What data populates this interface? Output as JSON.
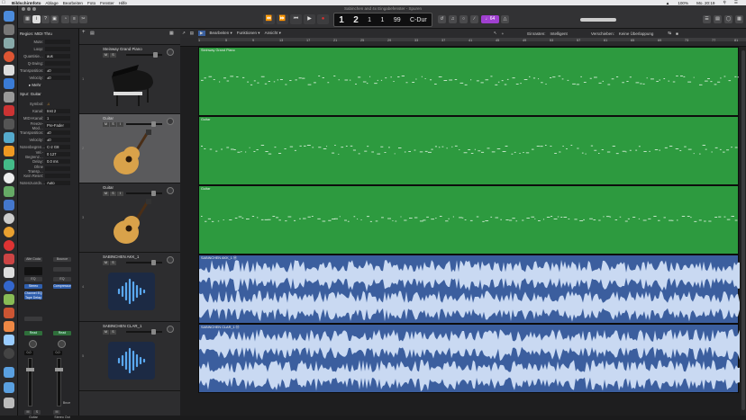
{
  "menubar": {
    "app": "Bildschirmfoto",
    "items": [
      "Ablage",
      "Bearbeiten",
      "Foto",
      "Fenster",
      "Hilfe"
    ],
    "clock": "Mo. 20:19",
    "battery": "100%"
  },
  "window": {
    "title": "Sabinchen and 4x Eingabefenster - Spuren"
  },
  "lcd": {
    "bar": "1",
    "beat": "2",
    "div": "1",
    "tick": "1",
    "tempo": "99",
    "key": "C-Dur",
    "zoom_icon": "metronome-icon"
  },
  "toolbar_right": {
    "badge": "♩64",
    "badge_color": "#a040d0"
  },
  "inspector": {
    "region_label": "Region: MIDI Thru",
    "rows": [
      {
        "k": "Mute:",
        "v": ""
      },
      {
        "k": "Loop:",
        "v": ""
      },
      {
        "k": "Quantisie…",
        "v": "aus"
      },
      {
        "k": "Q-Swing:",
        "v": ""
      },
      {
        "k": "Transposition:",
        "v": "±0"
      },
      {
        "k": "Velocity:",
        "v": "±0"
      }
    ],
    "more_label": "▸ Mehr",
    "track_label": "Spur: Guitar",
    "track_rows": [
      {
        "k": "Symbol:",
        "v": ""
      },
      {
        "k": "Kanal:",
        "v": "Inst 2"
      },
      {
        "k": "MIDI-Kanal:",
        "v": "1"
      },
      {
        "k": "Freeze-Mod…",
        "v": "Pre-Fader"
      },
      {
        "k": "Transposition:",
        "v": "±0"
      },
      {
        "k": "Velocity:",
        "v": "±0"
      },
      {
        "k": "Notenbegren…",
        "v": "C-2  G8"
      },
      {
        "k": "Vel.-Begrenz…",
        "v": "0  127"
      },
      {
        "k": "Delay:",
        "v": "0.0 ms"
      },
      {
        "k": "Ohne Transp…",
        "v": ""
      },
      {
        "k": "Kein Reset:",
        "v": ""
      },
      {
        "k": "Notenzuordn…",
        "v": "Auto"
      }
    ],
    "strip_a": {
      "slot1": "Alte Coda",
      "slot2": "EQ",
      "slot3": "Stereo",
      "input": "Channel EQ Tape Delay",
      "send": "Read",
      "value": "0,0",
      "name": "Guitar"
    },
    "strip_b": {
      "slot1": "Bounce",
      "slot2": "EQ",
      "slot3": "",
      "input": "Compressor",
      "send": "Read",
      "value": "0,0",
      "name": "Stereo Out",
      "bounce_label": "Bnce"
    },
    "m_label": "M",
    "s_label": "S",
    "i_label": "I"
  },
  "arrange_header": {
    "menus": [
      "Bearbeiten ▾",
      "Funktionen ▾",
      "Ansicht ▾"
    ],
    "snap_label": "Einrasten:",
    "snap_value": "Intelligent",
    "drag_label": "Verschieben:",
    "drag_value": "Keine Überlappung"
  },
  "ruler": {
    "ticks": [
      "1",
      "5",
      "9",
      "13",
      "17",
      "21",
      "25",
      "29",
      "33",
      "37",
      "41",
      "45",
      "49",
      "53",
      "57",
      "61",
      "65",
      "69",
      "73",
      "77",
      "81"
    ]
  },
  "tracks": [
    {
      "num": "1",
      "name": "Steinway Grand Piano",
      "art": "grand-piano"
    },
    {
      "num": "2",
      "name": "Guitar",
      "art": "acoustic-guitar"
    },
    {
      "num": "3",
      "name": "Guitar",
      "art": "acoustic-guitar"
    },
    {
      "num": "4",
      "name": "SABINCHEN AKK_1",
      "art": "audio-waveform"
    },
    {
      "num": "5",
      "name": "SABINCHEN CLAR_1",
      "art": "audio-waveform"
    }
  ],
  "regions": [
    {
      "name": "Steinway Grand Piano",
      "type": "midi",
      "color": "#2d9a3f"
    },
    {
      "name": "Guitar",
      "type": "midi",
      "color": "#2d9a3f"
    },
    {
      "name": "Guitar",
      "type": "midi",
      "color": "#2d9a3f"
    },
    {
      "name": "SABINCHEN AKK_1 Ⓜ",
      "type": "audio",
      "color": "#3b5e9e"
    },
    {
      "name": "SABINCHEN CLAR_1 Ⓜ",
      "type": "audio",
      "color": "#3b5e9e"
    }
  ]
}
